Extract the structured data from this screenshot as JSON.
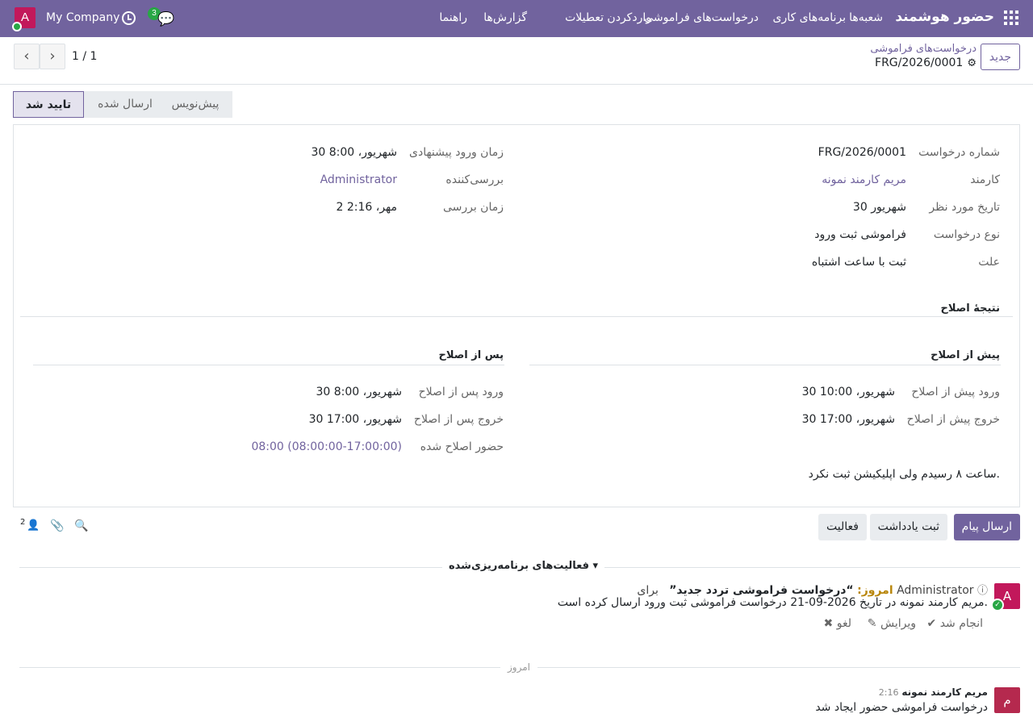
{
  "nav": {
    "brand": "حضور هوشمند",
    "menu": [
      "شعبه‌ها",
      "برنامه‌های کاری",
      "درخواست‌های فراموشی",
      "واردکردن تعطیلات",
      "گزارش‌ها",
      "راهنما"
    ],
    "company": "My Company",
    "avatar_letter": "A",
    "chat_badge": "3"
  },
  "control": {
    "new_button": "جدید",
    "breadcrumb_parent": "درخواست‌های فراموشی",
    "breadcrumb_current": "FRG/2026/0001",
    "pager_value": "1 / 1"
  },
  "status": {
    "stages": [
      "پیش‌نویس",
      "ارسال شده",
      "تایید شد"
    ],
    "active": "تایید شد"
  },
  "form": {
    "right": [
      {
        "label": "شماره درخواست",
        "value": "FRG/2026/0001",
        "link": false
      },
      {
        "label": "کارمند",
        "value": "مریم کارمند نمونه",
        "link": true
      },
      {
        "label": "تاریخ مورد نظر",
        "value": "30 شهریور",
        "link": false
      },
      {
        "label": "نوع درخواست",
        "value": "فراموشی ثبت ورود",
        "link": false
      },
      {
        "label": "علت",
        "value": "ثبت با ساعت اشتباه",
        "link": false
      }
    ],
    "left": [
      {
        "label": "زمان ورود پیشنهادی",
        "value": "30 شهریور، 8:00",
        "link": false
      },
      {
        "label": "بررسی‌کننده",
        "value": "Administrator",
        "link": true
      },
      {
        "label": "زمان بررسی",
        "value": "2 مهر، 2:16",
        "link": false
      }
    ],
    "section_title": "نتیجهٔ اصلاح",
    "before_title": "پیش از اصلاح",
    "after_title": "پس از اصلاح",
    "before": [
      {
        "label": "ورود پیش از اصلاح",
        "value": "30 شهریور، 10:00"
      },
      {
        "label": "خروج پیش از اصلاح",
        "value": "30 شهریور، 17:00"
      }
    ],
    "after": [
      {
        "label": "ورود پس از اصلاح",
        "value": "30 شهریور، 8:00"
      },
      {
        "label": "خروج پس از اصلاح",
        "value": "30 شهریور، 17:00"
      },
      {
        "label": "حضور اصلاح شده",
        "value": "08:00 (08:00:00-17:00:00)"
      }
    ],
    "note": "ساعت ۸ رسیدم ولی اپلیکیشن ثبت نکرد."
  },
  "chatter": {
    "send_message": "ارسال پیام",
    "log_note": "ثبت یادداشت",
    "activity": "فعالیت",
    "followers_count": "2",
    "planned_title": "فعالیت‌های برنامه‌ریزی‌شده",
    "activity_item": {
      "avatar": "A",
      "when": "امروز:",
      "summary": "“درخواست فراموشی تردد جدید”",
      "for_text": "برای",
      "assignee": "Administrator",
      "description": "مریم کارمند نمونه در تاریخ 2026-09-21 درخواست فراموشی ثبت ورود ارسال کرده است.",
      "done": "انجام شد",
      "edit": "ویرایش",
      "cancel": "لغو"
    },
    "date_separator": "امروز",
    "message": {
      "avatar": "م",
      "author": "مریم کارمند نمونه",
      "time": "2:16",
      "body": "درخواست فراموشی حضور ایجاد شد"
    }
  }
}
